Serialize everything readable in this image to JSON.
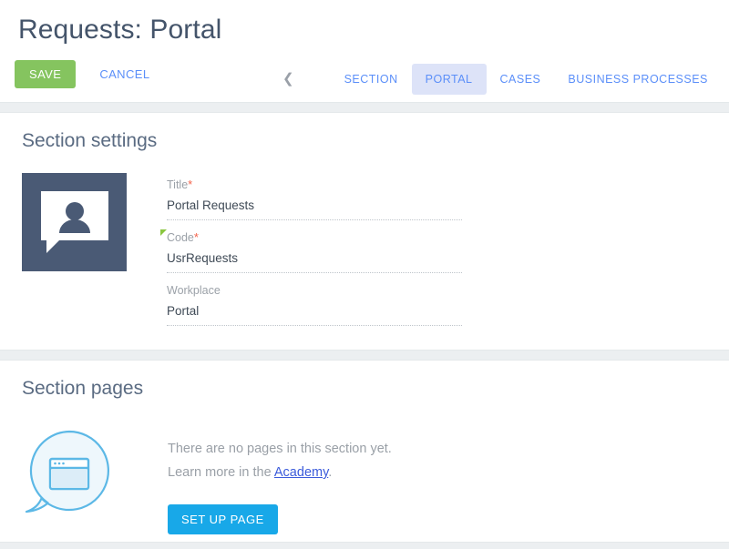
{
  "header": {
    "title": "Requests: Portal",
    "save_label": "SAVE",
    "cancel_label": "CANCEL"
  },
  "tabs": {
    "prev_icon": "chevron-left-icon",
    "next_icon": "chevron-right-icon",
    "items": [
      {
        "label": "SECTION",
        "active": false
      },
      {
        "label": "PORTAL",
        "active": true
      },
      {
        "label": "CASES",
        "active": false
      },
      {
        "label": "BUSINESS PROCESSES",
        "active": false
      }
    ]
  },
  "section_settings": {
    "heading": "Section settings",
    "icon_name": "speech-bubble-person-icon",
    "fields": [
      {
        "label": "Title",
        "required": true,
        "value": "Portal Requests",
        "flag": false
      },
      {
        "label": "Code",
        "required": true,
        "value": "UsrRequests",
        "flag": true
      },
      {
        "label": "Workplace",
        "required": false,
        "value": "Portal",
        "flag": false
      }
    ]
  },
  "section_pages": {
    "heading": "Section pages",
    "illustration_name": "speech-bubble-browser-window-icon",
    "empty_line_1": "There are no pages in this section yet.",
    "empty_line_2_prefix": "Learn more in the ",
    "empty_link": "Academy",
    "empty_line_2_suffix": ".",
    "setup_label": "SET UP PAGE"
  },
  "colors": {
    "save_green": "#85c45f",
    "accent_blue": "#5b8ff9",
    "setup_blue": "#18a8e8",
    "link_blue": "#3b5bdb",
    "icon_slate": "#4a5a75",
    "required_red": "#f4624a",
    "flag_green": "#8ac640",
    "active_tab_bg": "#dde3f8"
  }
}
